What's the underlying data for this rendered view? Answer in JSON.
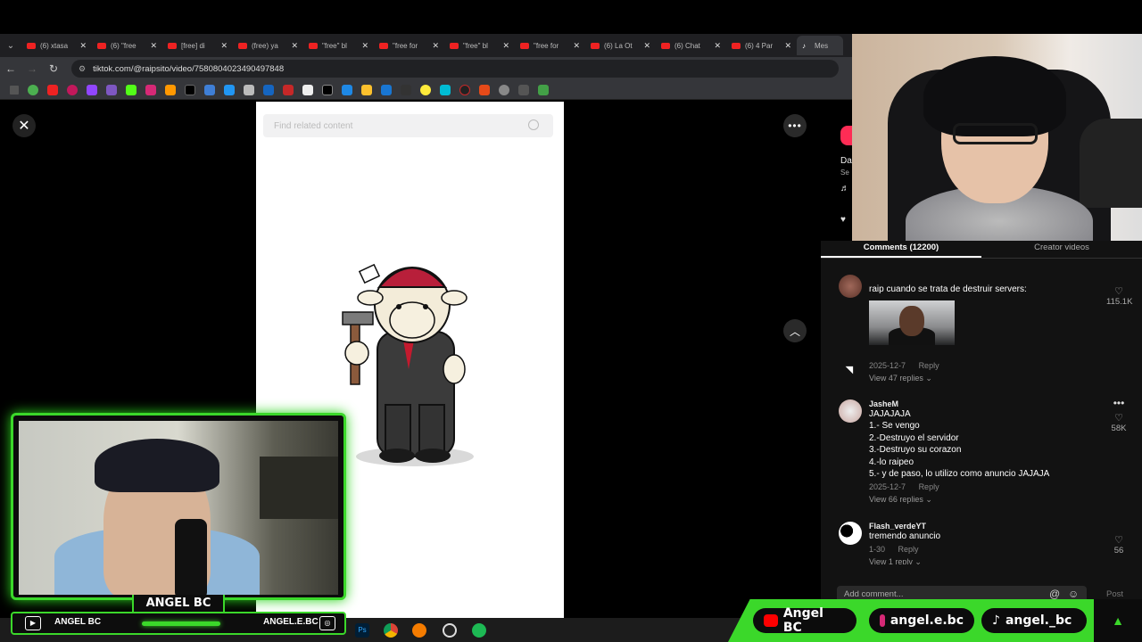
{
  "browser": {
    "tabs": [
      {
        "title": "(6) xtasa",
        "icon": "youtube-icon"
      },
      {
        "title": "(6) \"free",
        "icon": "youtube-icon"
      },
      {
        "title": "[free] di",
        "icon": "youtube-icon"
      },
      {
        "title": "(free) ya",
        "icon": "youtube-icon"
      },
      {
        "title": "\"free\" bl",
        "icon": "youtube-icon"
      },
      {
        "title": "\"free for",
        "icon": "youtube-icon"
      },
      {
        "title": "\"free\" bl",
        "icon": "youtube-icon"
      },
      {
        "title": "\"free for",
        "icon": "youtube-icon"
      },
      {
        "title": "(6) La Ot",
        "icon": "youtube-icon"
      },
      {
        "title": "(6) Chat",
        "icon": "youtube-icon"
      },
      {
        "title": "(6) 4 Par",
        "icon": "youtube-icon"
      },
      {
        "title": "Mes",
        "icon": "tiktok-icon"
      }
    ],
    "url": "tiktok.com/@raipsito/video/7580804023490497848"
  },
  "video": {
    "search_placeholder": "Find related content"
  },
  "side": {
    "name_snippet": "Da",
    "sub_snippet": "Se"
  },
  "comments": {
    "tab_comments": "Comments (12200)",
    "tab_creator": "Creator videos",
    "items": [
      {
        "user": "",
        "lines": [
          "raip cuando se trata de destruir servers:"
        ],
        "date": "2025-12-7",
        "reply": "Reply",
        "replies": "View 47 replies",
        "likes": "115.1K"
      },
      {
        "user": "JasheM",
        "lines": [
          "JAJAJAJA",
          "1.- Se vengo",
          "2.-Destruyo el servidor",
          "3.-Destruyo su corazon",
          "4.-lo raipeo",
          "5.- y de paso, lo utilizo como anuncio JAJAJA"
        ],
        "date": "2025-12-7",
        "reply": "Reply",
        "replies": "View 66 replies",
        "likes": "58K"
      },
      {
        "user": "Flash_verdeYT",
        "lines": [
          "tremendo anuncio"
        ],
        "date": "1-30",
        "reply": "Reply",
        "replies": "View 1 reply",
        "likes": "56"
      }
    ],
    "add_placeholder": "Add comment...",
    "post_label": "Post"
  },
  "stream_overlay": {
    "name": "ANGEL BC",
    "footer_left": "ANGEL BC",
    "footer_right": "ANGEL.E.BC",
    "socials": [
      {
        "label": "Angel BC",
        "icon": "youtube-icon",
        "color": "#ff0000"
      },
      {
        "label": "angel.e.bc",
        "icon": "instagram-icon",
        "color": "#d62976"
      },
      {
        "label": "angel._bc",
        "icon": "tiktok-icon",
        "color": "#ffffff"
      }
    ],
    "accent": "#3bd82a"
  }
}
